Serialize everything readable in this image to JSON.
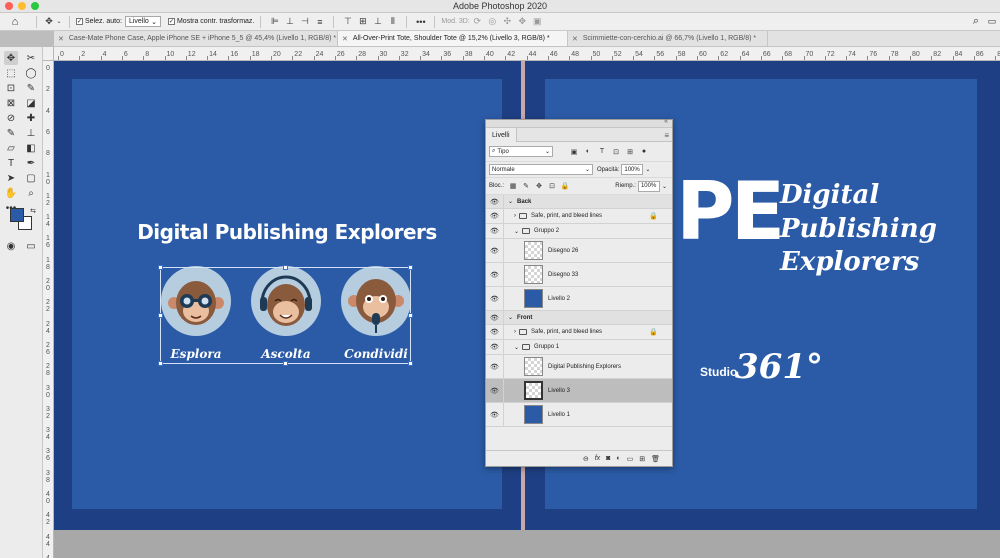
{
  "app": {
    "title": "Adobe Photoshop 2020"
  },
  "options_bar": {
    "auto_select_label": "Selez. auto:",
    "auto_select_value": "Livello",
    "transform_label": "Mostra contr. trasformaz.",
    "mode3d_label": "Mod. 3D:"
  },
  "tabs": [
    {
      "label": "Case-Mate Phone Case, Apple iPhone SE + iPhone 5_5 @ 45,4% (Livello 1, RGB/8) *"
    },
    {
      "label": "All-Over-Print Tote, Shoulder Tote @ 15,2% (Livello 3, RGB/8) *"
    },
    {
      "label": "Scimmiette-con-cerchio.ai @ 66,7% (Livello 1, RGB/8) *"
    }
  ],
  "ruler": {
    "top": [
      "0",
      "2",
      "4",
      "6",
      "8",
      "10",
      "12",
      "14",
      "16",
      "18",
      "20",
      "22",
      "24",
      "26",
      "28",
      "30",
      "32",
      "34",
      "36",
      "38",
      "40",
      "42",
      "44",
      "46",
      "48",
      "50",
      "52",
      "54",
      "56",
      "58",
      "60",
      "62",
      "64",
      "66",
      "68",
      "70",
      "72",
      "74",
      "76",
      "78",
      "80",
      "82",
      "84",
      "86",
      "88"
    ],
    "left": [
      "0",
      "2",
      "4",
      "6",
      "8",
      "1\n0",
      "1\n2",
      "1\n4",
      "1\n6",
      "1\n8",
      "2\n0",
      "2\n2",
      "2\n4",
      "2\n6",
      "2\n8",
      "3\n0",
      "3\n2",
      "3\n4",
      "3\n6",
      "3\n8",
      "4\n0",
      "4\n2",
      "4\n4",
      "4\n6"
    ]
  },
  "artwork": {
    "front_heading": "Digital Publishing Explorers",
    "mascots": [
      {
        "label": "Esplora"
      },
      {
        "label": "Ascolta"
      },
      {
        "label": "Condividi"
      }
    ],
    "back_initials": "PE",
    "back_script": [
      "Digital",
      "Publishing",
      "Explorers"
    ],
    "studio_word": "Studio",
    "studio_number": "361°"
  },
  "colors": {
    "artboard": "#2b5ba6",
    "artboard_frame": "#1e3f83",
    "mascot_circle": "#b6cde0",
    "selection": "#d5e3f7"
  },
  "layers_panel": {
    "tab": "Livelli",
    "filter": "Tipo",
    "blend_mode": "Normale",
    "opacity_label": "Opacità:",
    "opacity": "100%",
    "lock_label": "Bloc.:",
    "fill_label": "Riemp.:",
    "fill": "100%",
    "layers": [
      {
        "name": "Back",
        "kind": "group"
      },
      {
        "name": "Safe, print, and bleed lines",
        "kind": "folder-locked"
      },
      {
        "name": "Gruppo 2",
        "kind": "folder-open"
      },
      {
        "name": "Disegno 26",
        "kind": "smart"
      },
      {
        "name": "Disegno 33",
        "kind": "smart"
      },
      {
        "name": "Livello 2",
        "kind": "fill"
      },
      {
        "name": "Front",
        "kind": "group"
      },
      {
        "name": "Safe, print, and bleed lines",
        "kind": "folder-locked"
      },
      {
        "name": "Gruppo 1",
        "kind": "folder-open"
      },
      {
        "name": "Digital Publishing Explorers",
        "kind": "text"
      },
      {
        "name": "Livello 3",
        "kind": "selected"
      },
      {
        "name": "Livello 1",
        "kind": "fill"
      }
    ]
  }
}
